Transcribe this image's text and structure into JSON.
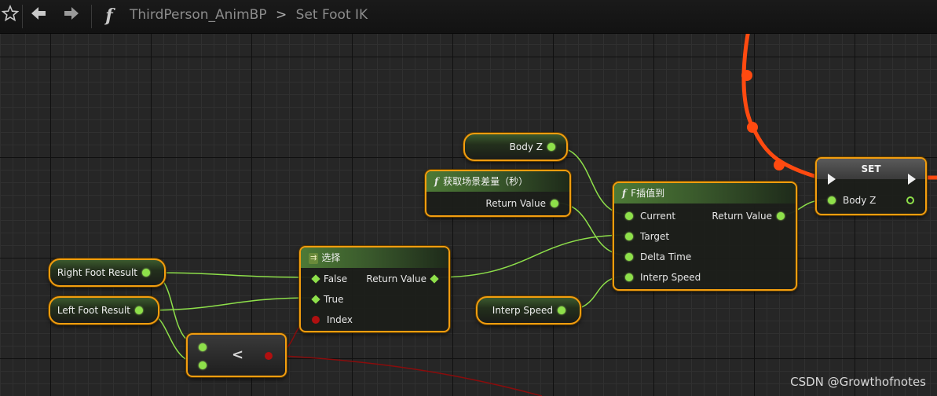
{
  "toolbar": {
    "star_icon": "star-icon",
    "back_icon": "back-arrow-icon",
    "forward_icon": "forward-arrow-icon",
    "function_icon": "function-icon",
    "function_glyph": "f"
  },
  "breadcrumb": {
    "blueprint": "ThirdPerson_AnimBP",
    "separator": ">",
    "function": "Set Foot IK"
  },
  "nodes": {
    "body_z_get": {
      "label": "Body Z"
    },
    "get_world_delta": {
      "title": "获取场景差量（秒）",
      "return_label": "Return Value"
    },
    "finterp": {
      "title": "F插值到",
      "inputs": [
        "Current",
        "Target",
        "Delta Time",
        "Interp Speed"
      ],
      "return_label": "Return Value"
    },
    "set_node": {
      "title": "SET",
      "pin_label": "Body Z"
    },
    "right_foot": {
      "label": "Right Foot Result"
    },
    "left_foot": {
      "label": "Left Foot Result"
    },
    "select": {
      "title": "选择",
      "inputs": [
        "False",
        "True",
        "Index"
      ],
      "return_label": "Return Value"
    },
    "interp_speed": {
      "label": "Interp Speed"
    },
    "less_than": {
      "label": "<"
    }
  },
  "colors": {
    "node_border": "#f29d0f",
    "float_pin": "#8ee04a",
    "bool_pin": "#b01010",
    "exec_wire": "#ff4a10",
    "float_wire": "#8ee04a"
  },
  "watermark": "CSDN @Growthofnotes"
}
